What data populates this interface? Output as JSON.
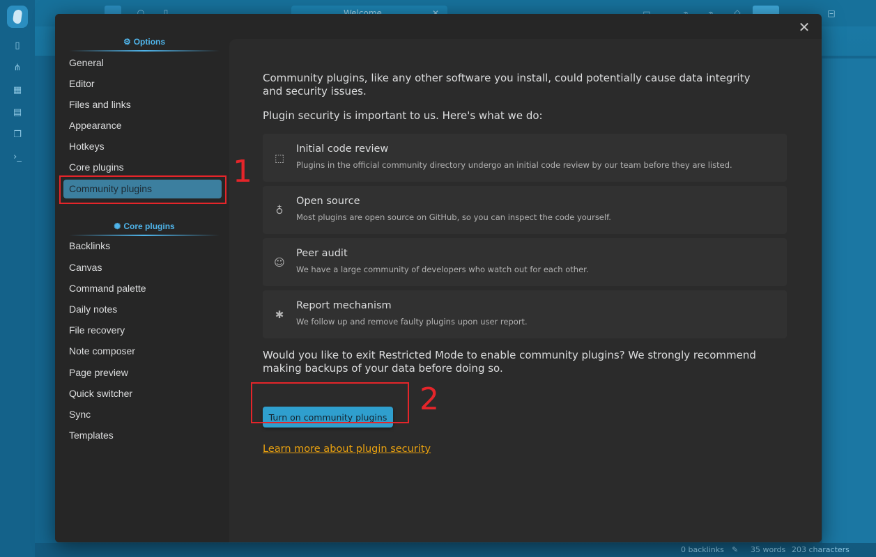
{
  "background": {
    "tab_label": "Welcome",
    "status": {
      "backlinks": "0 backlinks",
      "words": "35 words",
      "characters": "203 characters"
    }
  },
  "sidebar": {
    "options_header": "Options",
    "options_items": [
      {
        "label": "General"
      },
      {
        "label": "Editor"
      },
      {
        "label": "Files and links"
      },
      {
        "label": "Appearance"
      },
      {
        "label": "Hotkeys"
      },
      {
        "label": "Core plugins"
      },
      {
        "label": "Community plugins",
        "active": true
      }
    ],
    "core_header": "Core plugins",
    "core_items": [
      {
        "label": "Backlinks"
      },
      {
        "label": "Canvas"
      },
      {
        "label": "Command palette"
      },
      {
        "label": "Daily notes"
      },
      {
        "label": "File recovery"
      },
      {
        "label": "Note composer"
      },
      {
        "label": "Page preview"
      },
      {
        "label": "Quick switcher"
      },
      {
        "label": "Sync"
      },
      {
        "label": "Templates"
      }
    ]
  },
  "content": {
    "intro": "Community plugins, like any other software you install, could potentially cause data integrity and security issues.",
    "security_intro": "Plugin security is important to us. Here's what we do:",
    "cards": [
      {
        "icon": "code-review-icon",
        "title": "Initial code review",
        "desc": "Plugins in the official community directory undergo an initial code review by our team before they are listed."
      },
      {
        "icon": "github-icon",
        "title": "Open source",
        "desc": "Most plugins are open source on GitHub, so you can inspect the code yourself."
      },
      {
        "icon": "users-icon",
        "title": "Peer audit",
        "desc": "We have a large community of developers who watch out for each other."
      },
      {
        "icon": "bug-icon",
        "title": "Report mechanism",
        "desc": "We follow up and remove faulty plugins upon user report."
      }
    ],
    "question": "Would you like to exit Restricted Mode to enable community plugins? We strongly recommend making backups of your data before doing so.",
    "button_label": "Turn on community plugins",
    "link_label": "Learn more about plugin security"
  },
  "annotations": {
    "one": "1",
    "two": "2"
  },
  "colors": {
    "accent": "#4fb4ea",
    "button": "#2f9fce",
    "link": "#e9a10f",
    "annotation": "#e5252a"
  }
}
